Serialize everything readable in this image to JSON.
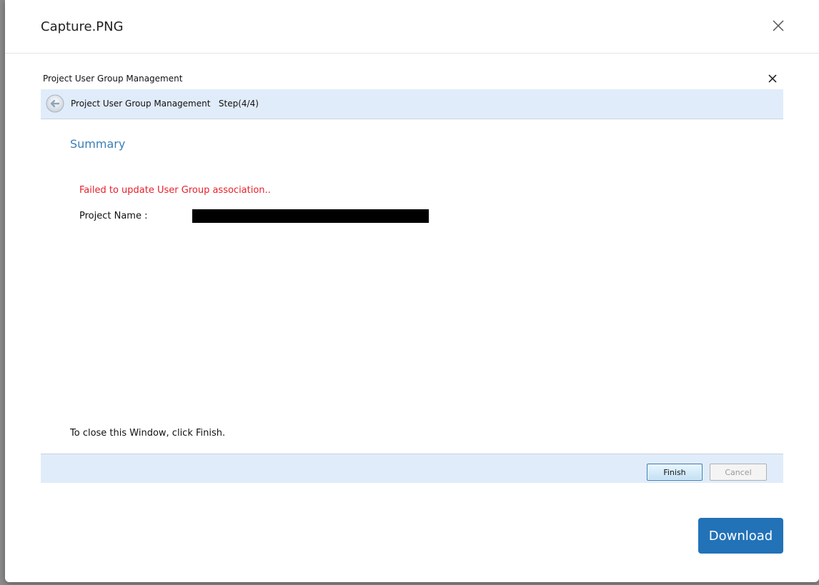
{
  "modal": {
    "title": "Capture.PNG",
    "download_label": "Download"
  },
  "wizard": {
    "window_title": "Project User Group Management",
    "step_title": "Project User Group Management",
    "step_indicator": "Step(4/4)",
    "section_heading": "Summary",
    "error_message": "Failed to update User Group association..",
    "project_name_label": "Project Name :",
    "close_hint": "To close this Window, click Finish.",
    "finish_label": "Finish",
    "cancel_label": "Cancel"
  },
  "colors": {
    "accent": "#2272b8",
    "heading": "#3a7fb5",
    "error": "#e8202a",
    "bar_background": "#e1ecfa"
  }
}
